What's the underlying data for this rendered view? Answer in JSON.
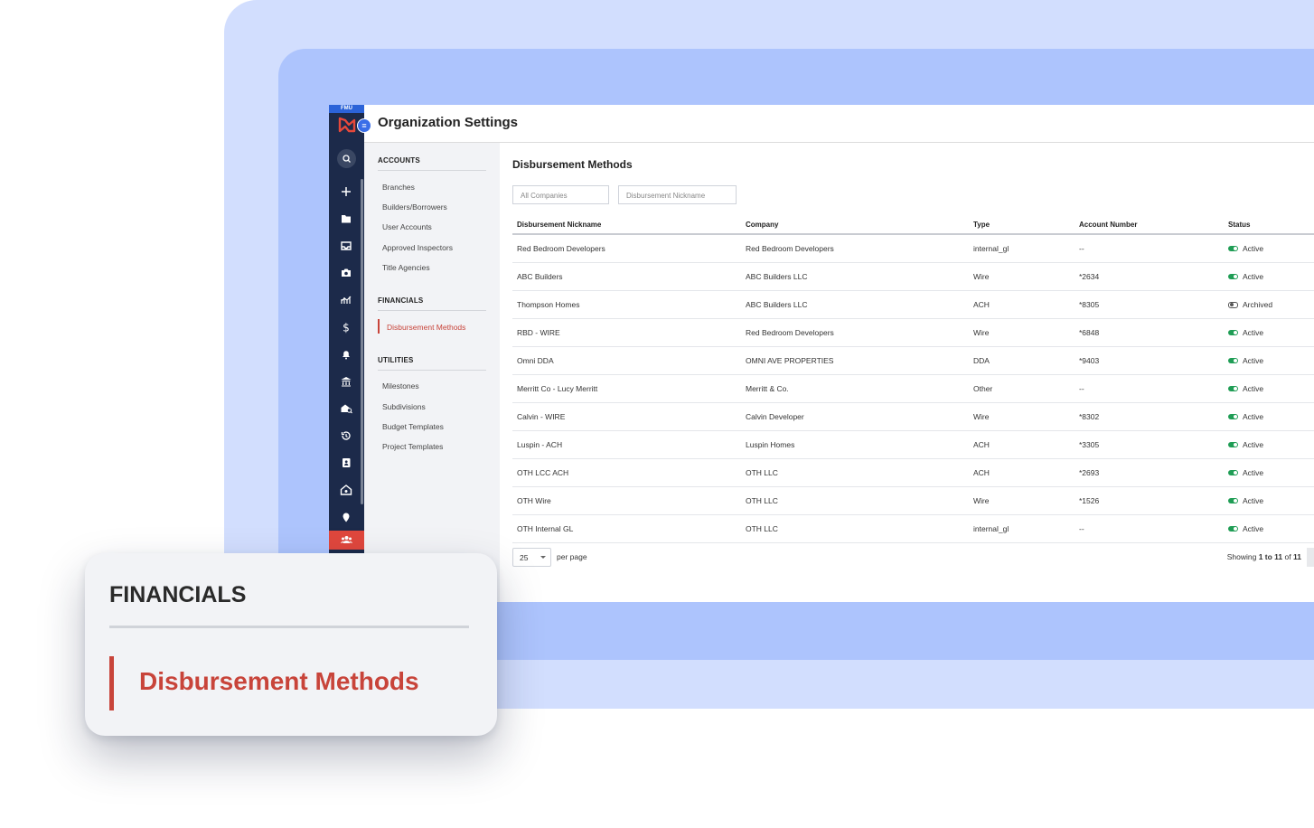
{
  "app": {
    "env_tag": "FMU",
    "page_title": "Organization Settings"
  },
  "sidebar": {
    "sections": [
      {
        "title": "ACCOUNTS",
        "items": [
          "Branches",
          "Builders/Borrowers",
          "User Accounts",
          "Approved Inspectors",
          "Title Agencies"
        ]
      },
      {
        "title": "FINANCIALS",
        "items": [
          "Disbursement Methods"
        ]
      },
      {
        "title": "UTILITIES",
        "items": [
          "Milestones",
          "Subdivisions",
          "Budget Templates",
          "Project Templates"
        ]
      }
    ],
    "active_item": "Disbursement Methods"
  },
  "main": {
    "heading": "Disbursement Methods",
    "filters": {
      "company_placeholder": "All Companies",
      "nickname_placeholder": "Disbursement Nickname"
    },
    "table": {
      "columns": [
        "Disbursement Nickname",
        "Company",
        "Type",
        "Account Number",
        "Status"
      ],
      "rows": [
        [
          "Red Bedroom Developers",
          "Red Bedroom Developers",
          "internal_gl",
          "--",
          "Active"
        ],
        [
          "ABC Builders",
          "ABC Builders LLC",
          "Wire",
          "*2634",
          "Active"
        ],
        [
          "Thompson Homes",
          "ABC Builders LLC",
          "ACH",
          "*8305",
          "Archived"
        ],
        [
          "RBD - WIRE",
          "Red Bedroom Developers",
          "Wire",
          "*6848",
          "Active"
        ],
        [
          "Omni DDA",
          "OMNI AVE PROPERTIES",
          "DDA",
          "*9403",
          "Active"
        ],
        [
          "Merritt Co - Lucy Merritt",
          "Merritt & Co.",
          "Other",
          "--",
          "Active"
        ],
        [
          "Calvin - WIRE",
          "Calvin Developer",
          "Wire",
          "*8302",
          "Active"
        ],
        [
          "Luspin - ACH",
          "Luspin Homes",
          "ACH",
          "*3305",
          "Active"
        ],
        [
          "OTH LCC ACH",
          "OTH LLC",
          "ACH",
          "*2693",
          "Active"
        ],
        [
          "OTH Wire",
          "OTH LLC",
          "Wire",
          "*1526",
          "Active"
        ],
        [
          "OTH Internal GL",
          "OTH LLC",
          "internal_gl",
          "--",
          "Active"
        ]
      ]
    },
    "pagination": {
      "per_page_value": "25",
      "per_page_label": "per page",
      "showing_prefix": "Showing",
      "showing_range": "1 to 11",
      "showing_of": "of",
      "showing_total": "11"
    }
  },
  "callout": {
    "section_title": "FINANCIALS",
    "link_label": "Disbursement Methods"
  },
  "colors": {
    "rail": "#1c2a4a",
    "accent_red": "#c8443a",
    "active_green": "#1f9d55",
    "bg_light_blue": "#d2defe",
    "bg_mid_blue": "#adc4fd"
  },
  "rail_icons": [
    "search-icon",
    "plus-icon",
    "folder-icon",
    "inbox-icon",
    "camera-icon",
    "chart-icon",
    "dollar-icon",
    "bell-icon",
    "bank-icon",
    "inspection-icon",
    "history-icon",
    "contacts-icon",
    "home-settings-icon",
    "map-pin-icon",
    "team-icon"
  ]
}
